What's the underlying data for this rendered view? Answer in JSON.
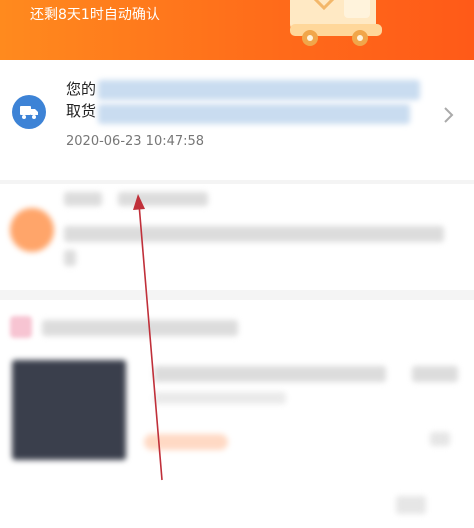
{
  "header": {
    "status_text": "还剩8天1时自动确认",
    "accent_color": "#ff6a1a"
  },
  "logistics": {
    "line1_prefix": "您的",
    "line2_prefix": "取货",
    "timestamp": "2020-06-23 10:47:58",
    "icon": "truck-icon",
    "badge_color": "#3d83d6"
  },
  "annotation": {
    "arrow_color": "#c0303a"
  }
}
